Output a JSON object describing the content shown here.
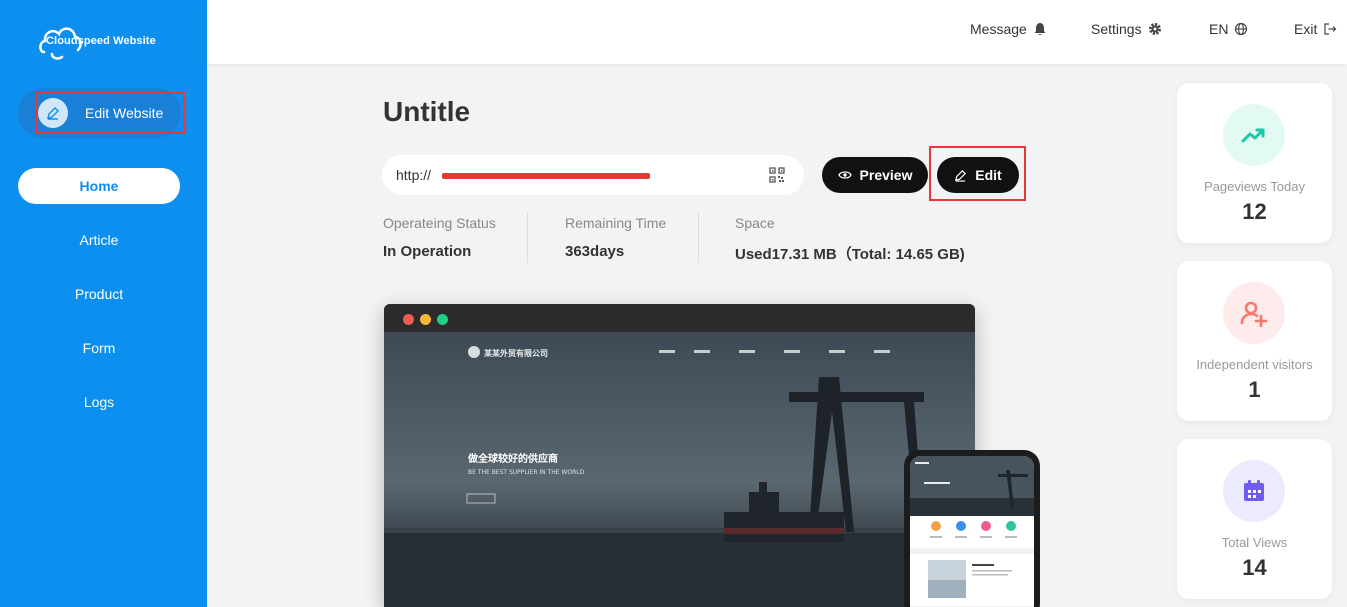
{
  "sidebar": {
    "logo_text": "Cloudspeed Website",
    "edit_website_label": "Edit Website",
    "nav": [
      {
        "label": "Home",
        "active": true
      },
      {
        "label": "Article",
        "active": false
      },
      {
        "label": "Product",
        "active": false
      },
      {
        "label": "Form",
        "active": false
      },
      {
        "label": "Logs",
        "active": false
      }
    ]
  },
  "topbar": {
    "message": "Message",
    "settings": "Settings",
    "language": "EN",
    "exit": "Exit"
  },
  "site": {
    "title": "Untitle",
    "url": "http://",
    "preview_label": "Preview",
    "edit_label": "Edit"
  },
  "status": {
    "operating_label": "Operateing Status",
    "operating_value": "In Operation",
    "remaining_label": "Remaining Time",
    "remaining_value": "363days",
    "space_label": "Space",
    "space_value": "Used17.31 MB（Total:  14.65 GB)"
  },
  "preview_mock": {
    "brand_cn": "某某外贸有限公司",
    "headline_cn": "做全球较好的供应商",
    "headline_en": "BE THE BEST SUPPLIER IN THE WORLD"
  },
  "stats_cards": [
    {
      "label": "Pageviews Today",
      "value": "12",
      "icon": "trend-up-icon",
      "color": "#19c9a8"
    },
    {
      "label": "Independent visitors",
      "value": "1",
      "icon": "user-add-icon",
      "color": "#f8776a"
    },
    {
      "label": "Total Views",
      "value": "14",
      "icon": "calendar-icon",
      "color": "#6f5cf0"
    }
  ],
  "colors": {
    "sidebar": "#0d8ff0",
    "highlight": "#e53935",
    "button": "#111111"
  }
}
